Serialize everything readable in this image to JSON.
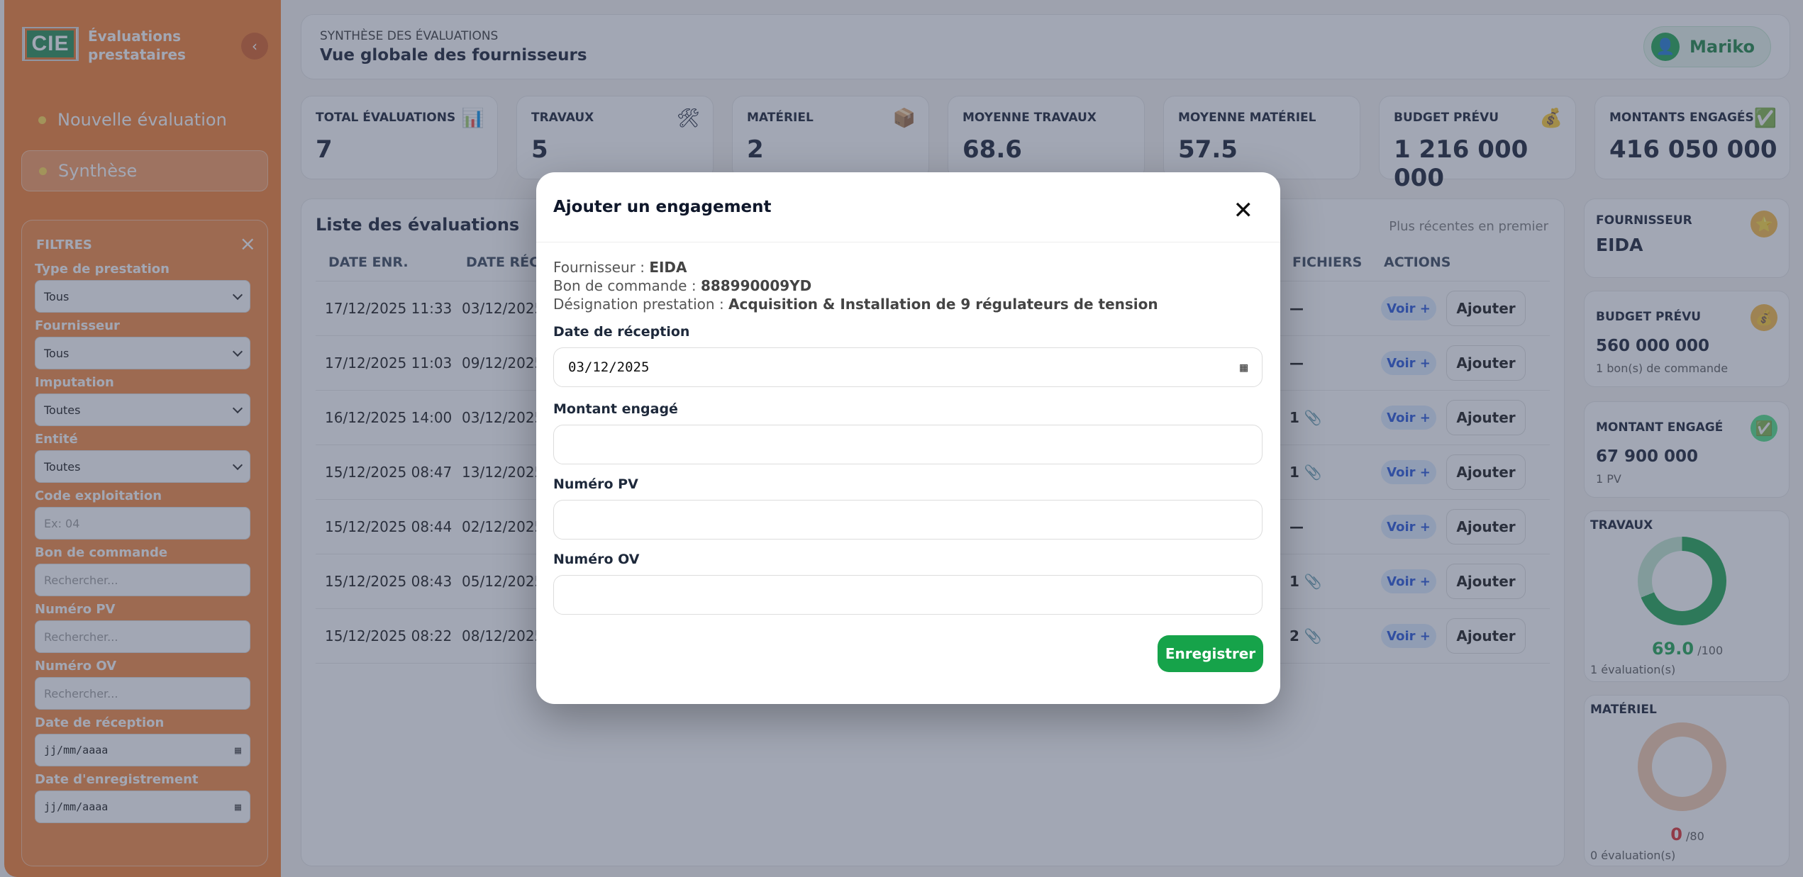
{
  "sidebar": {
    "logo_text": "CIE",
    "app_title": "Évaluations prestataires",
    "collapse_glyph": "‹",
    "nav": [
      {
        "label": "Nouvelle évaluation"
      },
      {
        "label": "Synthèse"
      }
    ],
    "filters": {
      "title": "FILTRES",
      "fields": [
        {
          "label": "Type de prestation",
          "value": "Tous"
        },
        {
          "label": "Fournisseur",
          "value": "Tous"
        },
        {
          "label": "Imputation",
          "value": "Toutes"
        },
        {
          "label": "Entité",
          "value": "Toutes"
        },
        {
          "label": "Code exploitation",
          "placeholder": "Ex: 04"
        },
        {
          "label": "Bon de commande",
          "placeholder": "Rechercher..."
        },
        {
          "label": "Numéro PV",
          "placeholder": "Rechercher..."
        },
        {
          "label": "Numéro OV",
          "placeholder": "Rechercher..."
        },
        {
          "label": "Date de réception",
          "placeholder": "jj/mm/aaaa"
        },
        {
          "label": "Date d'enregistrement",
          "placeholder": "jj/mm/aaaa"
        }
      ]
    }
  },
  "header": {
    "subtitle": "SYNTHÈSE DES ÉVALUATIONS",
    "title": "Vue globale des fournisseurs",
    "user": "Mariko"
  },
  "stats": [
    {
      "label": "TOTAL ÉVALUATIONS",
      "value": "7",
      "icon": "📊"
    },
    {
      "label": "TRAVAUX",
      "value": "5",
      "icon": "🛠"
    },
    {
      "label": "MATÉRIEL",
      "value": "2",
      "icon": "📦"
    },
    {
      "label": "MOYENNE TRAVAUX",
      "value": "68.6",
      "icon": ""
    },
    {
      "label": "MOYENNE MATÉRIEL",
      "value": "57.5",
      "icon": ""
    },
    {
      "label": "BUDGET PRÉVU",
      "value": "1 216 000 000",
      "icon": "💰"
    },
    {
      "label": "MONTANTS ENGAGÉS",
      "value": "416 050 000",
      "icon": "✅"
    }
  ],
  "list": {
    "title": "Liste des évaluations",
    "sort": "Plus récentes en premier",
    "columns": [
      "DATE ENR.",
      "DATE RÉC.",
      "FICHIERS",
      "ACTIONS"
    ],
    "action_view": "Voir +",
    "action_add": "Ajouter",
    "rows": [
      {
        "date_enr": "17/12/2025 11:33",
        "date_rec": "03/12/2025",
        "files": "—"
      },
      {
        "date_enr": "17/12/2025 11:03",
        "date_rec": "09/12/2025",
        "files": "—"
      },
      {
        "date_enr": "16/12/2025 14:00",
        "date_rec": "03/12/2025",
        "files": "1 📎"
      },
      {
        "date_enr": "15/12/2025 08:47",
        "date_rec": "13/12/2025",
        "files": "1 📎"
      },
      {
        "date_enr": "15/12/2025 08:44",
        "date_rec": "02/12/2025",
        "files": "—"
      },
      {
        "date_enr": "15/12/2025 08:43",
        "date_rec": "05/12/2025",
        "files": "1 📎"
      },
      {
        "date_enr": "15/12/2025 08:22",
        "date_rec": "08/12/2025",
        "files": "2 📎"
      }
    ]
  },
  "right": {
    "supplier": {
      "label": "FOURNISSEUR",
      "value": "EIDA",
      "icon": "⭐"
    },
    "budget": {
      "label": "BUDGET PRÉVU",
      "value": "560 000 000",
      "sub": "1 bon(s) de commande",
      "icon": "💰"
    },
    "engaged": {
      "label": "MONTANT ENGAGÉ",
      "value": "67 900 000",
      "sub": "1 PV",
      "icon": "✅"
    },
    "travaux": {
      "label": "TRAVAUX",
      "score": "69.0",
      "max": "/100",
      "score_fraction": 0.69,
      "count": "1 évaluation(s)"
    },
    "materiel": {
      "label": "MATÉRIEL",
      "score": "0",
      "max": "/80",
      "score_fraction": 0,
      "count": "0 évaluation(s)"
    }
  },
  "modal": {
    "title": "Ajouter un engagement",
    "close": "✕",
    "info": [
      {
        "label": "Fournisseur :",
        "value": "EIDA"
      },
      {
        "label": "Bon de commande :",
        "value": "888990009YD"
      },
      {
        "label": "Désignation prestation :",
        "value": "Acquisition & Installation de 9 régulateurs de tension"
      }
    ],
    "fields": [
      {
        "label": "Date de réception",
        "value": "03/12/2025"
      },
      {
        "label": "Montant engagé",
        "value": ""
      },
      {
        "label": "Numéro PV",
        "value": ""
      },
      {
        "label": "Numéro OV",
        "value": ""
      }
    ],
    "save": "Enregistrer"
  },
  "colors": {
    "sidebar": "#f47a29",
    "accent_green": "#16a34a",
    "gauge_travaux": "#16a34a",
    "gauge_materiel": "#f4c9a8"
  }
}
